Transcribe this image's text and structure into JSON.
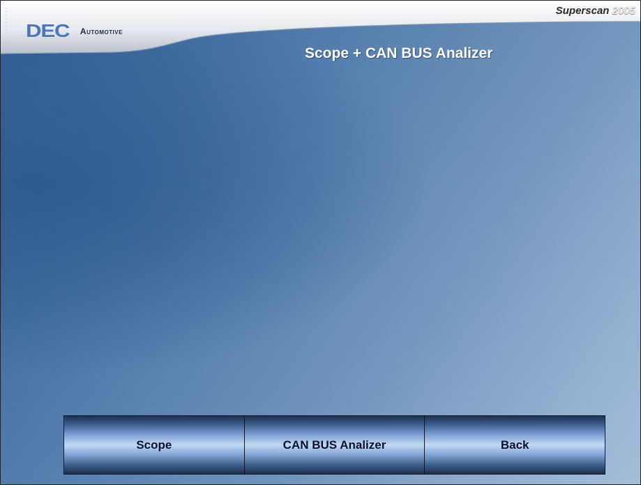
{
  "header": {
    "logo_mark": "DEC",
    "logo_text": "Automotive",
    "app_name": "Superscan",
    "app_year": "2005"
  },
  "page": {
    "title": "Scope + CAN BUS Analizer"
  },
  "buttons": [
    {
      "label": "Scope"
    },
    {
      "label": "CAN BUS Analizer"
    },
    {
      "label": "Back"
    }
  ]
}
